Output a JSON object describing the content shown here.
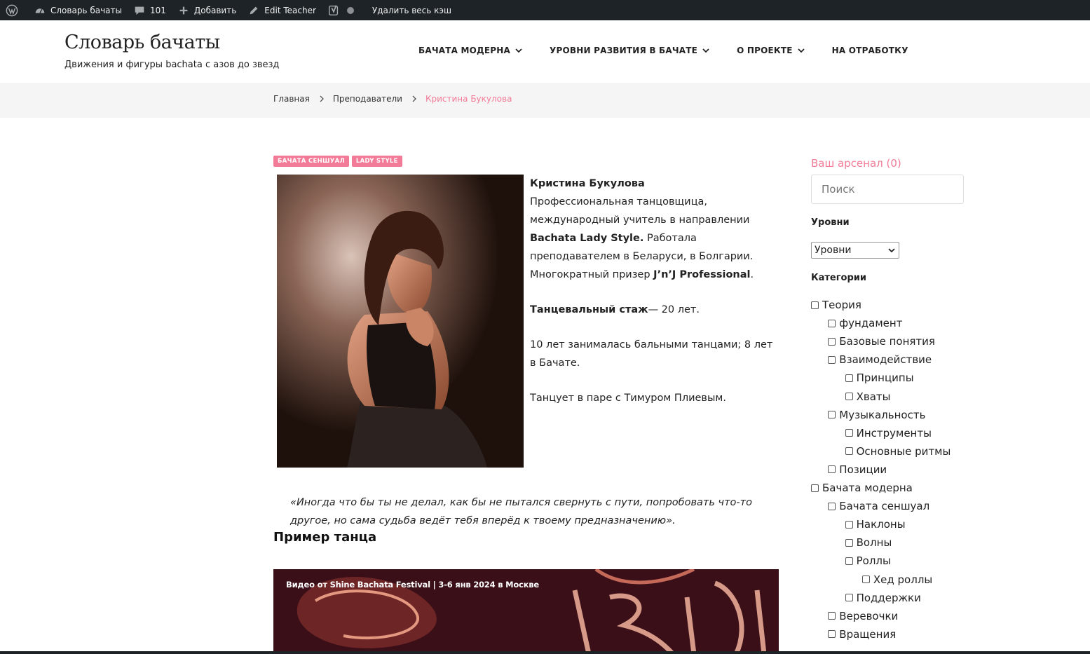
{
  "admin_bar": {
    "site_name": "Словарь бачаты",
    "comments_count": "101",
    "add_label": "Добавить",
    "edit_label": "Edit Teacher",
    "clear_cache_label": "Удалить весь кэш"
  },
  "header": {
    "site_title": "Словарь бачаты",
    "site_description": "Движения и фигуры bachata с азов до звезд",
    "nav": [
      {
        "label": "БАЧАТА МОДЕРНА",
        "has_submenu": true
      },
      {
        "label": "УРОВНИ РАЗВИТИЯ В БАЧАТЕ",
        "has_submenu": true
      },
      {
        "label": "О ПРОЕКТЕ",
        "has_submenu": true
      },
      {
        "label": "НА ОТРАБОТКУ",
        "has_submenu": false
      }
    ]
  },
  "breadcrumb": {
    "items": [
      "Главная",
      "Преподаватели"
    ],
    "current": "Кристина Букулова"
  },
  "tags": [
    "БАЧАТА СЕНШУАЛ",
    "LADY STYLE"
  ],
  "bio": {
    "name": "Кристина Букулова",
    "intro_1": "Профессиональная танцовщица, международный учитель в направлении ",
    "intro_style": "Bachata Lady Style.",
    "intro_2": "  Работала преподавателем в Беларуси, в Болгарии. Многократный призер ",
    "intro_award": "J’n’J Professional",
    "intro_end": ".",
    "experience_label": "Танцевальный стаж",
    "experience_value": "— 20 лет.",
    "history": "10 лет занималась бальными танцами; 8 лет в Бачате.",
    "partner": "Танцует в паре с Тимуром Плиевым."
  },
  "quote": "«Иногда что бы ты не делал, как бы не пытался свернуть с пути, попробовать что-то другое, но сама судьба ведёт тебя вперёд к твоему предназначению».",
  "example_heading": "Пример танца",
  "video": {
    "title": "Видео от Shine Bachata Festival | 3-6 янв 2024 в Москве"
  },
  "sidebar": {
    "arsenal_label": "Ваш арсенал (0)",
    "search_placeholder": "Поиск",
    "levels_title": "Уровни",
    "levels_selected": "Уровни",
    "categories_title": "Категории",
    "categories": [
      {
        "label": "Теория",
        "level": 0
      },
      {
        "label": "фундамент",
        "level": 1
      },
      {
        "label": "Базовые понятия",
        "level": 1
      },
      {
        "label": "Взаимодействие",
        "level": 1
      },
      {
        "label": "Принципы",
        "level": 2
      },
      {
        "label": "Хваты",
        "level": 2
      },
      {
        "label": "Музыкальность",
        "level": 1
      },
      {
        "label": "Инструменты",
        "level": 2
      },
      {
        "label": "Основные ритмы",
        "level": 2
      },
      {
        "label": "Позиции",
        "level": 1
      },
      {
        "label": "Бачата модерна",
        "level": 0
      },
      {
        "label": "Бачата сеншуал",
        "level": 1
      },
      {
        "label": "Наклоны",
        "level": 2
      },
      {
        "label": "Волны",
        "level": 2
      },
      {
        "label": "Роллы",
        "level": 2
      },
      {
        "label": "Хед роллы",
        "level": 3
      },
      {
        "label": "Поддержки",
        "level": 2
      },
      {
        "label": "Веревочки",
        "level": 1
      },
      {
        "label": "Вращения",
        "level": 1
      }
    ]
  },
  "colors": {
    "accent": "#f27b97",
    "admin_bar": "#1d2327"
  }
}
